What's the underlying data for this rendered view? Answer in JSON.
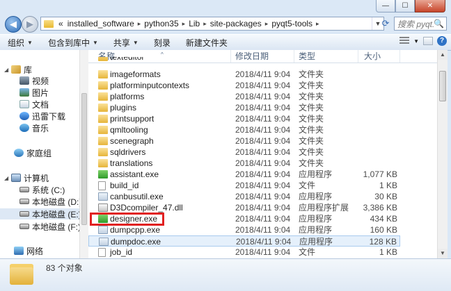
{
  "window": {
    "caption_buttons": {
      "minimize": "—",
      "maximize": "☐",
      "close": "✕"
    }
  },
  "navbar": {
    "back_glyph": "◀",
    "forward_glyph": "▶",
    "breadcrumbs": [
      "«",
      "installed_software",
      "python35",
      "Lib",
      "site-packages",
      "pyqt5-tools"
    ],
    "crumb_sep": "▸",
    "dropdown_glyph": "▼",
    "refresh_glyph": "⟳",
    "search_placeholder": "搜索 pyqt...",
    "search_glyph": "🔍"
  },
  "commandbar": {
    "organize": "组织",
    "include_in_library": "包含到库中",
    "share": "共享",
    "burn": "刻录",
    "new_folder": "新建文件夹",
    "dropdown_arrow": "▼",
    "help": "?"
  },
  "sidebar": {
    "libraries": "库",
    "items": [
      "视频",
      "图片",
      "文档",
      "迅雷下载",
      "音乐"
    ],
    "homegroup": "家庭组",
    "computer": "计算机",
    "drives": [
      "系统 (C:)",
      "本地磁盘 (D:)",
      "本地磁盘 (E:)",
      "本地磁盘 (F:)"
    ],
    "network": "网络"
  },
  "columns": {
    "name": "名称",
    "date": "修改日期",
    "type": "类型",
    "size": "大小",
    "sort_glyph": "^"
  },
  "files": [
    {
      "name": "imageformats",
      "date": "2018/4/11 9:04",
      "type": "文件夹",
      "size": "",
      "icon": "folder"
    },
    {
      "name": "platforminputcontexts",
      "date": "2018/4/11 9:04",
      "type": "文件夹",
      "size": "",
      "icon": "folder"
    },
    {
      "name": "platforms",
      "date": "2018/4/11 9:04",
      "type": "文件夹",
      "size": "",
      "icon": "folder"
    },
    {
      "name": "plugins",
      "date": "2018/4/11 9:04",
      "type": "文件夹",
      "size": "",
      "icon": "folder"
    },
    {
      "name": "printsupport",
      "date": "2018/4/11 9:04",
      "type": "文件夹",
      "size": "",
      "icon": "folder"
    },
    {
      "name": "qmltooling",
      "date": "2018/4/11 9:04",
      "type": "文件夹",
      "size": "",
      "icon": "folder"
    },
    {
      "name": "scenegraph",
      "date": "2018/4/11 9:04",
      "type": "文件夹",
      "size": "",
      "icon": "folder"
    },
    {
      "name": "sqldrivers",
      "date": "2018/4/11 9:04",
      "type": "文件夹",
      "size": "",
      "icon": "folder"
    },
    {
      "name": "translations",
      "date": "2018/4/11 9:04",
      "type": "文件夹",
      "size": "",
      "icon": "folder"
    },
    {
      "name": "assistant.exe",
      "date": "2018/4/11 9:04",
      "type": "应用程序",
      "size": "1,077 KB",
      "icon": "qt"
    },
    {
      "name": "build_id",
      "date": "2018/4/11 9:04",
      "type": "文件",
      "size": "1 KB",
      "icon": "file"
    },
    {
      "name": "canbusutil.exe",
      "date": "2018/4/11 9:04",
      "type": "应用程序",
      "size": "30 KB",
      "icon": "exe"
    },
    {
      "name": "D3Dcompiler_47.dll",
      "date": "2018/4/11 9:04",
      "type": "应用程序扩展",
      "size": "3,386 KB",
      "icon": "dll"
    },
    {
      "name": "designer.exe",
      "date": "2018/4/11 9:04",
      "type": "应用程序",
      "size": "434 KB",
      "icon": "qt"
    },
    {
      "name": "dumpcpp.exe",
      "date": "2018/4/11 9:04",
      "type": "应用程序",
      "size": "160 KB",
      "icon": "exe"
    },
    {
      "name": "dumpdoc.exe",
      "date": "2018/4/11 9:04",
      "type": "应用程序",
      "size": "128 KB",
      "icon": "exe"
    },
    {
      "name": "job_id",
      "date": "2018/4/11 9:04",
      "type": "文件",
      "size": "1 KB",
      "icon": "file"
    }
  ],
  "partial_top_row": "texteditor",
  "selected_row": 15,
  "status": {
    "count": "83 个对象"
  },
  "scroll_glyphs": {
    "up": "▲",
    "down": "▼"
  },
  "colors": {
    "highlight": "#e12020",
    "selection": "#e5f0fb"
  }
}
